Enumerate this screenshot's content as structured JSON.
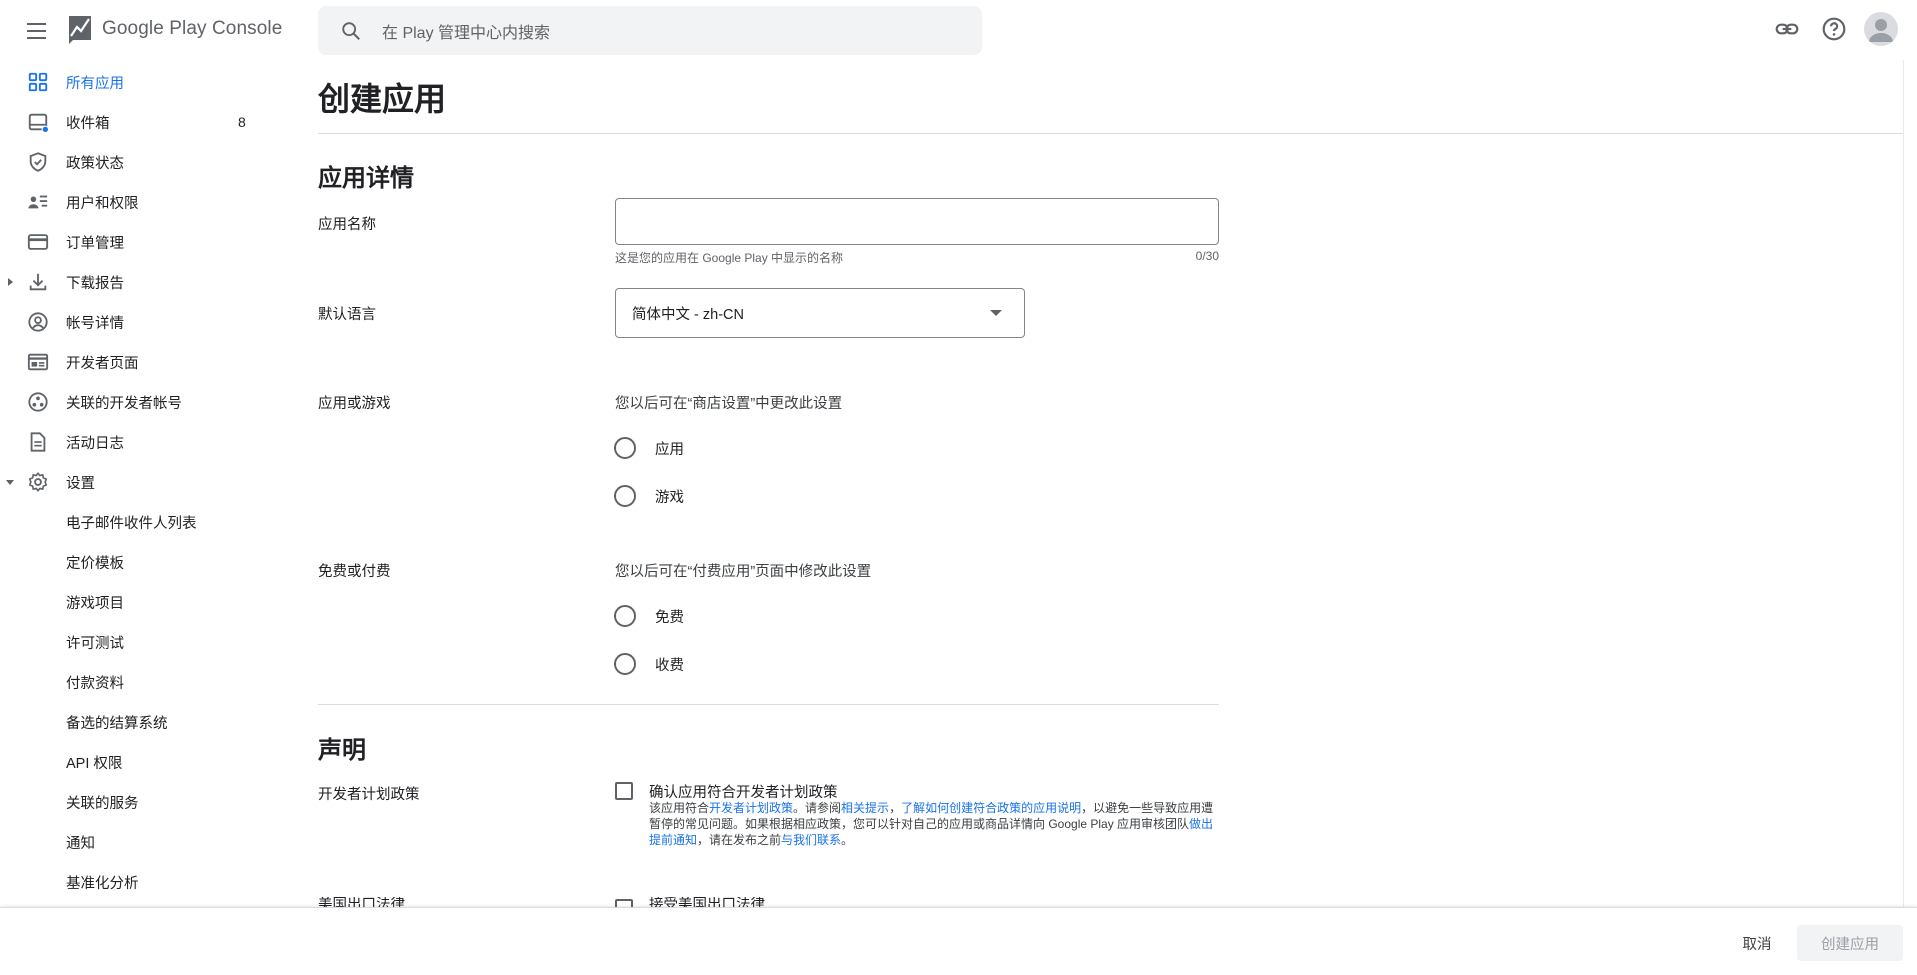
{
  "header": {
    "app_title": "Google Play Console",
    "search_placeholder": "在 Play 管理中心内搜索"
  },
  "sidebar": {
    "items": [
      {
        "label": "所有应用",
        "icon": "grid-icon",
        "active": true
      },
      {
        "label": "收件箱",
        "icon": "inbox-icon",
        "count": "8"
      },
      {
        "label": "政策状态",
        "icon": "shield-check-icon"
      },
      {
        "label": "用户和权限",
        "icon": "users-list-icon"
      },
      {
        "label": "订单管理",
        "icon": "credit-card-icon"
      },
      {
        "label": "下载报告",
        "icon": "download-icon"
      },
      {
        "label": "帐号详情",
        "icon": "account-circle-icon"
      },
      {
        "label": "开发者页面",
        "icon": "web-page-icon"
      },
      {
        "label": "关联的开发者帐号",
        "icon": "linked-accounts-icon"
      },
      {
        "label": "活动日志",
        "icon": "document-icon"
      },
      {
        "label": "设置",
        "icon": "gear-icon"
      }
    ],
    "settings_sub_items": [
      "电子邮件收件人列表",
      "定价模板",
      "游戏项目",
      "许可测试",
      "付款资料",
      "备选的结算系统",
      "API 权限",
      "关联的服务",
      "通知",
      "基准化分析"
    ]
  },
  "main": {
    "page_title": "创建应用",
    "app_details": {
      "section_title": "应用详情",
      "app_name_label": "应用名称",
      "app_name_value": "",
      "app_name_helper": "这是您的应用在 Google Play 中显示的名称",
      "app_name_counter": "0/30",
      "default_language_label": "默认语言",
      "default_language_value": "简体中文 - zh-CN",
      "app_or_game_label": "应用或游戏",
      "app_or_game_hint": "您以后可在“商店设置”中更改此设置",
      "app_option": "应用",
      "game_option": "游戏",
      "free_or_paid_label": "免费或付费",
      "free_or_paid_hint": "您以后可在“付费应用”页面中修改此设置",
      "free_option": "免费",
      "paid_option": "收费"
    },
    "declarations": {
      "section_title": "声明",
      "developer_policy_label": "开发者计划政策",
      "developer_policy_checkbox": "确认应用符合开发者计划政策",
      "policy_text": {
        "p1": "该应用符合",
        "link1": "开发者计划政策",
        "p2": "。请参阅",
        "link2": "相关提示",
        "p3": "，",
        "link3": "了解如何创建符合政策的应用说明",
        "p4": "，以避免一些导致应用遭暂停的常见问题。如果根据相应政策，您可以针对自己的应用或商品详情向 Google Play 应用审核团队",
        "link4": "做出提前通知",
        "p5": "，请在发布之前",
        "link5": "与我们联系",
        "p6": "。"
      },
      "export_law_label": "美国出口法律",
      "export_law_checkbox": "接受美国出口法律"
    }
  },
  "footer": {
    "cancel_label": "取消",
    "create_label": "创建应用"
  },
  "colors": {
    "accent": "#1a73e8",
    "text": "#202124",
    "icon": "#5f6368",
    "divider": "#dadce0",
    "disabled_button_bg": "#f1f3f4"
  }
}
